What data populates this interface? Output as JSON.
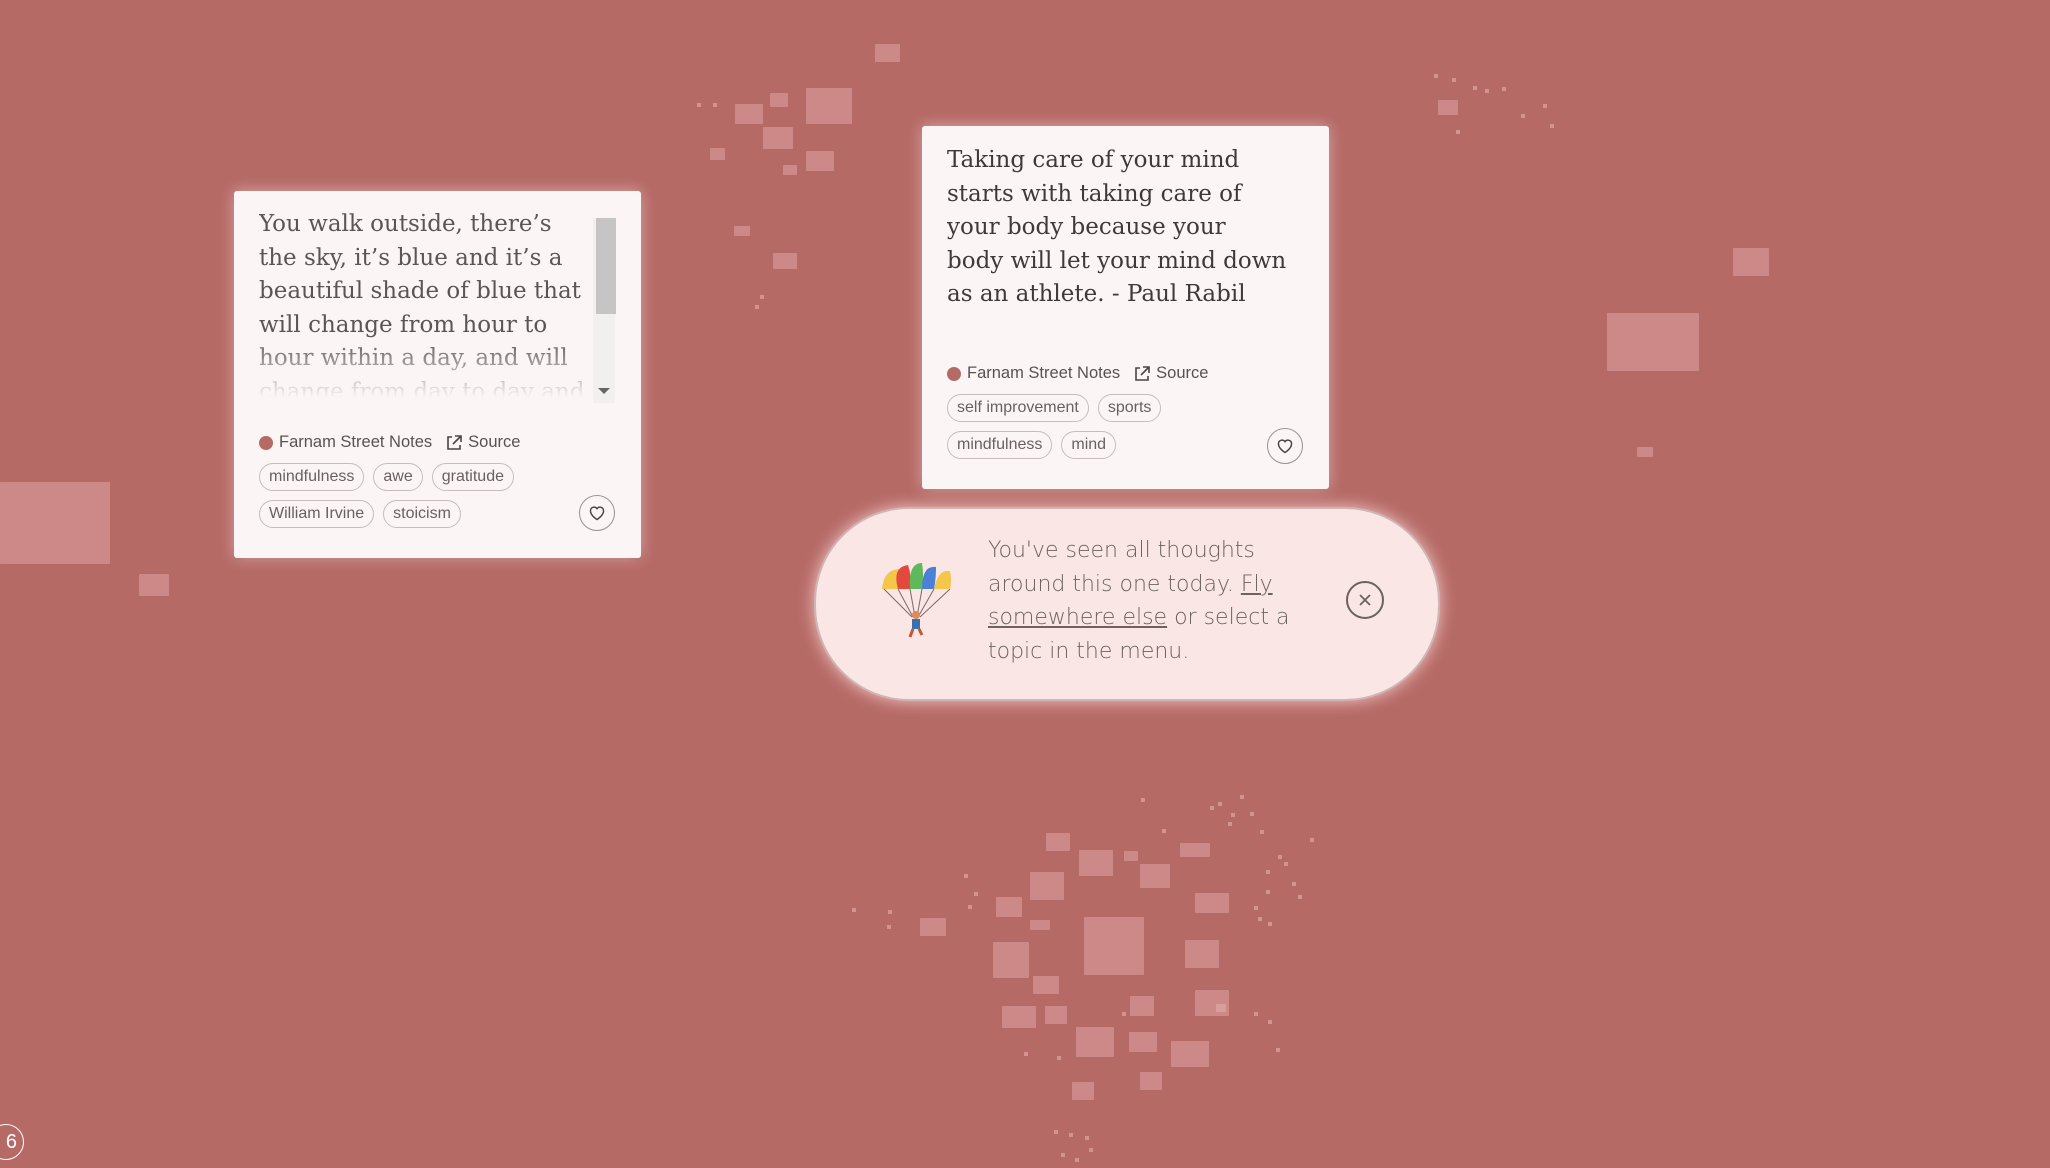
{
  "colors": {
    "background": "#b66a66",
    "card": "#fbf6f5",
    "toast": "#fae6e4",
    "source_dot": "#b66a66"
  },
  "cards": [
    {
      "quote": "You walk outside, there’s the sky, it’s blue and it’s a beautiful shade of blue that will change from hour to hour within a day, and will change from day to day and it didn’t have to be that way. You",
      "source_name": "Farnam Street Notes",
      "source_link": "Source",
      "tags": [
        "mindfulness",
        "awe",
        "gratitude",
        "William Irvine",
        "stoicism"
      ],
      "favorite_icon": "heart-icon"
    },
    {
      "quote": "Taking care of your mind starts with taking care of your body because your body will let your mind down as an athlete. - Paul Rabil",
      "source_name": "Farnam Street Notes",
      "source_link": "Source",
      "tags": [
        "self improvement",
        "sports",
        "mindfulness",
        "mind"
      ],
      "favorite_icon": "heart-icon"
    }
  ],
  "toast": {
    "text_before": "You've seen all thoughts around this one today. ",
    "link": "Fly somewhere else",
    "text_after": " or select a topic in the menu.",
    "icon": "parachute-icon",
    "close_icon": "close-icon"
  },
  "counter": "6"
}
